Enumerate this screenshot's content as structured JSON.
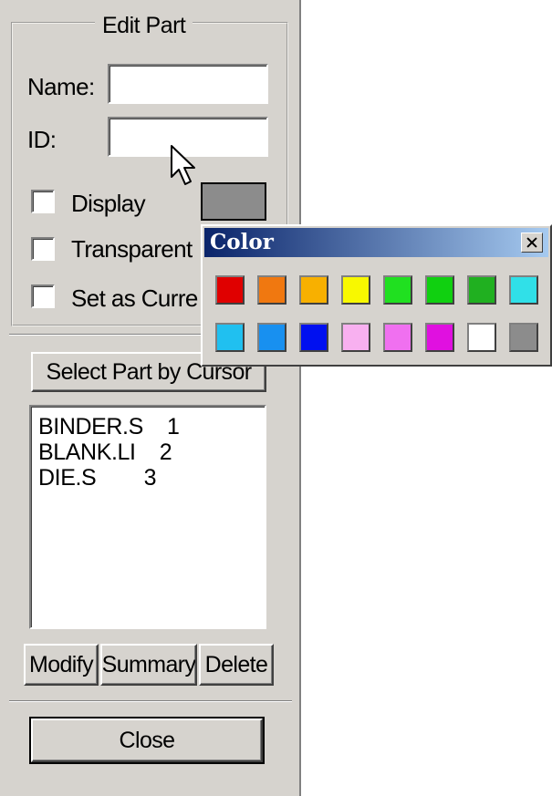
{
  "edit_part": {
    "title": "Edit Part",
    "name_label": "Name:",
    "name_value": "",
    "id_label": "ID:",
    "id_value": "",
    "display_label": "Display",
    "transparent_label": "Transparent",
    "set_current_label": "Set as Curre",
    "display_color": "#8c8c8c",
    "select_button": "Select Part by Cursor",
    "parts": [
      {
        "text": "BINDER.S    1"
      },
      {
        "text": "BLANK.LI    2"
      },
      {
        "text": "DIE.S        3"
      }
    ],
    "modify_button": "Modify",
    "summary_button": "Summary",
    "delete_button": "Delete",
    "close_button": "Close"
  },
  "color_popup": {
    "title": "Color",
    "colors": [
      "#e00000",
      "#f07810",
      "#f8b000",
      "#f8f800",
      "#20e020",
      "#10d010",
      "#20b020",
      "#30e0e8",
      "#20c0f0",
      "#1890f0",
      "#0010f0",
      "#f8b0f0",
      "#f070f0",
      "#e010e0",
      "#ffffff",
      "#8c8c8c"
    ]
  },
  "icons": {
    "cursor": "mouse-pointer-icon",
    "close": "close-icon"
  }
}
